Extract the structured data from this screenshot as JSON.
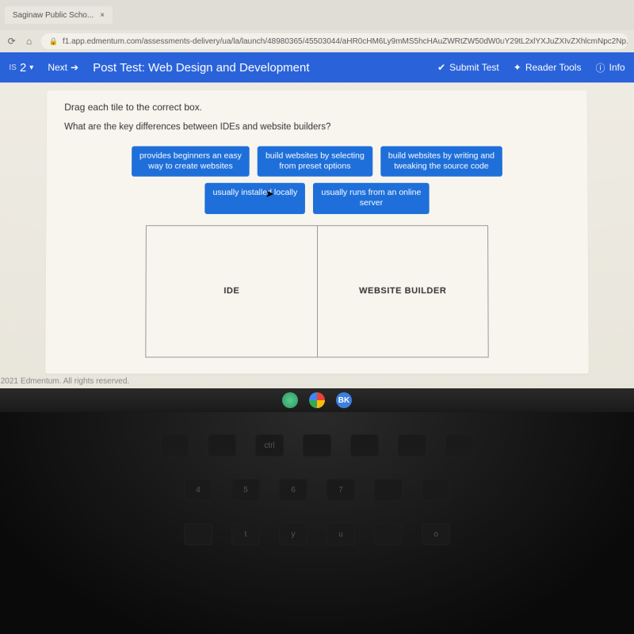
{
  "browser": {
    "tab_label": "Saginaw Public Scho...",
    "url": "f1.app.edmentum.com/assessments-delivery/ua/la/launch/48980365/45503044/aHR0cHM6Ly9mMS5hcHAuZWRtZW50dW0uY29tL2xlYXJuZXIvZXhlcmNpc2Np..."
  },
  "header": {
    "section_number": "2",
    "next_label": "Next",
    "title": "Post Test: Web Design and Development",
    "submit_label": "Submit Test",
    "reader_label": "Reader Tools",
    "info_label": "Info"
  },
  "content": {
    "instruction": "Drag each tile to the correct box.",
    "question": "What are the key differences between IDEs and website builders?",
    "tiles_row1": [
      "provides beginners an easy\nway to create websites",
      "build websites by selecting\nfrom preset options",
      "build websites by writing and\ntweaking the source code"
    ],
    "tiles_row2": [
      "usually installed locally",
      "usually runs from an online\nserver"
    ],
    "drop_left_label": "IDE",
    "drop_right_label": "WEBSITE BUILDER"
  },
  "footer": {
    "copyright": "2021 Edmentum. All rights reserved."
  },
  "taskbar": {
    "icon3_text": "BK"
  }
}
